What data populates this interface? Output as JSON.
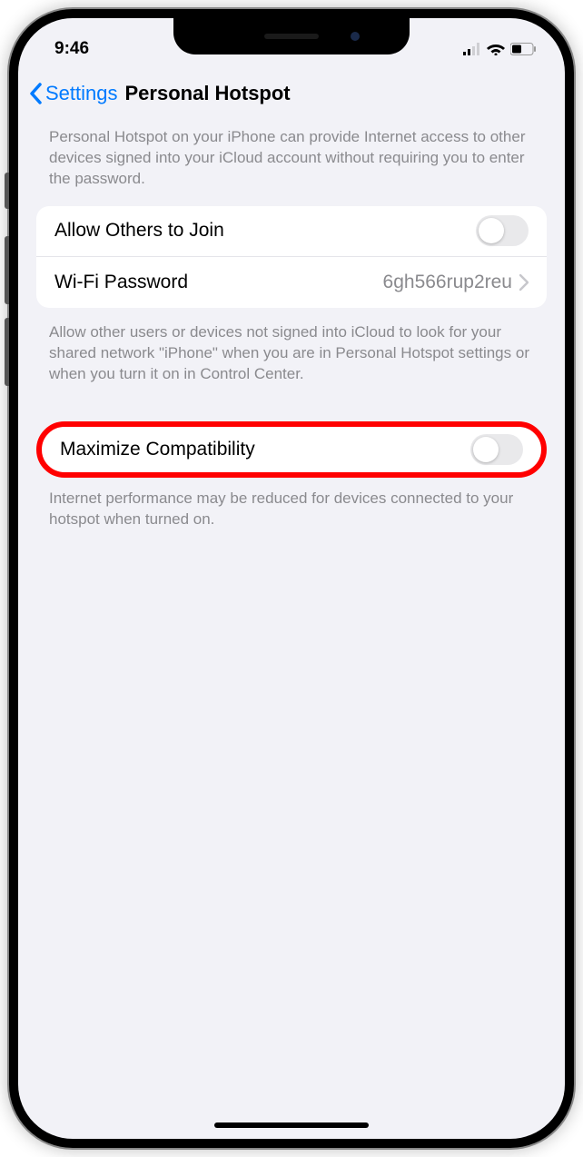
{
  "statusBar": {
    "time": "9:46"
  },
  "nav": {
    "back": "Settings",
    "title": "Personal Hotspot"
  },
  "desc1": "Personal Hotspot on your iPhone can provide Internet access to other devices signed into your iCloud account without requiring you to enter the password.",
  "group1": {
    "allowOthers": "Allow Others to Join",
    "wifiLabel": "Wi-Fi Password",
    "wifiValue": "6gh566rup2reu"
  },
  "desc2": "Allow other users or devices not signed into iCloud to look for your shared network \"iPhone\" when you are in Personal Hotspot settings or when you turn it on in Control Center.",
  "group2": {
    "maxCompat": "Maximize Compatibility"
  },
  "desc3": "Internet performance may be reduced for devices connected to your hotspot when turned on."
}
